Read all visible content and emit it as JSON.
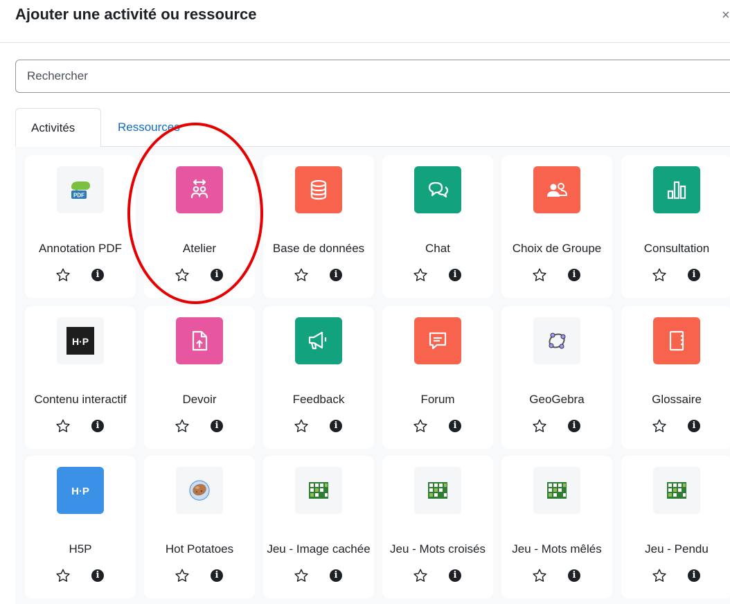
{
  "modal": {
    "title": "Ajouter une activité ou ressource",
    "close_glyph": "×"
  },
  "search": {
    "placeholder": "Rechercher"
  },
  "tabs": [
    {
      "label": "Activités"
    },
    {
      "label": "Ressources"
    }
  ],
  "colors": {
    "pink": "#e7579f",
    "red": "#f7634d",
    "green": "#12a37e",
    "blue": "#3b91e6",
    "accent_link": "#0f6cbf",
    "annotation": "#e60000"
  },
  "cards": [
    {
      "label": "Annotation PDF",
      "icon": "pdf-annotation-icon"
    },
    {
      "label": "Atelier",
      "icon": "workshop-icon"
    },
    {
      "label": "Base de données",
      "icon": "database-icon"
    },
    {
      "label": "Chat",
      "icon": "chat-icon"
    },
    {
      "label": "Choix de Groupe",
      "icon": "group-choice-icon"
    },
    {
      "label": "Consultation",
      "icon": "survey-icon"
    },
    {
      "label": "Contenu interactif",
      "icon": "h5p-black-icon"
    },
    {
      "label": "Devoir",
      "icon": "assignment-icon"
    },
    {
      "label": "Feedback",
      "icon": "feedback-icon"
    },
    {
      "label": "Forum",
      "icon": "forum-icon"
    },
    {
      "label": "GeoGebra",
      "icon": "geogebra-icon"
    },
    {
      "label": "Glossaire",
      "icon": "glossary-icon"
    },
    {
      "label": "H5P",
      "icon": "h5p-blue-icon"
    },
    {
      "label": "Hot Potatoes",
      "icon": "hot-potatoes-icon"
    },
    {
      "label": "Jeu - Image cachée",
      "icon": "game-grid-icon"
    },
    {
      "label": "Jeu - Mots croisés",
      "icon": "game-grid-icon"
    },
    {
      "label": "Jeu - Mots mêlés",
      "icon": "game-grid-icon"
    },
    {
      "label": "Jeu - Pendu",
      "icon": "game-grid-icon"
    }
  ]
}
